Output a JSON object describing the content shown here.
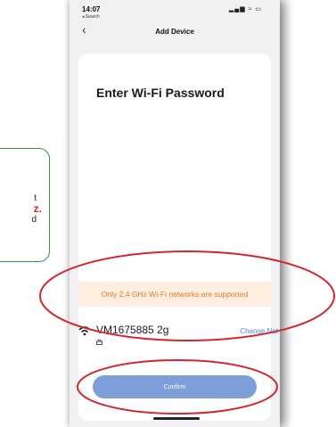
{
  "status_bar": {
    "time": "14:07",
    "back_app": "◂ Search",
    "icons": "▂▄▆ ≈ ▭"
  },
  "nav": {
    "back_glyph": "‹",
    "title": "Add Device"
  },
  "main": {
    "heading": "Enter Wi-Fi Password",
    "notice": "Only 2.4 GHz Wi-Fi networks are supported",
    "network_name": "VM1675885 2g",
    "change_network": "Change Net",
    "confirm_label": "Confirm"
  },
  "callout": {
    "line1": "t",
    "red_text": "z.",
    "line3": "d"
  },
  "colors": {
    "accent": "#7d9ed9",
    "link": "#4f86d8",
    "notice_text": "#e07b2a",
    "notice_bg": "#fdeee0",
    "highlight_ellipse": "#d0282f",
    "callout_border": "#2e9a48"
  },
  "icons": {
    "wifi": "wifi-icon",
    "lock": "lock-icon",
    "back": "chevron-left-icon"
  }
}
